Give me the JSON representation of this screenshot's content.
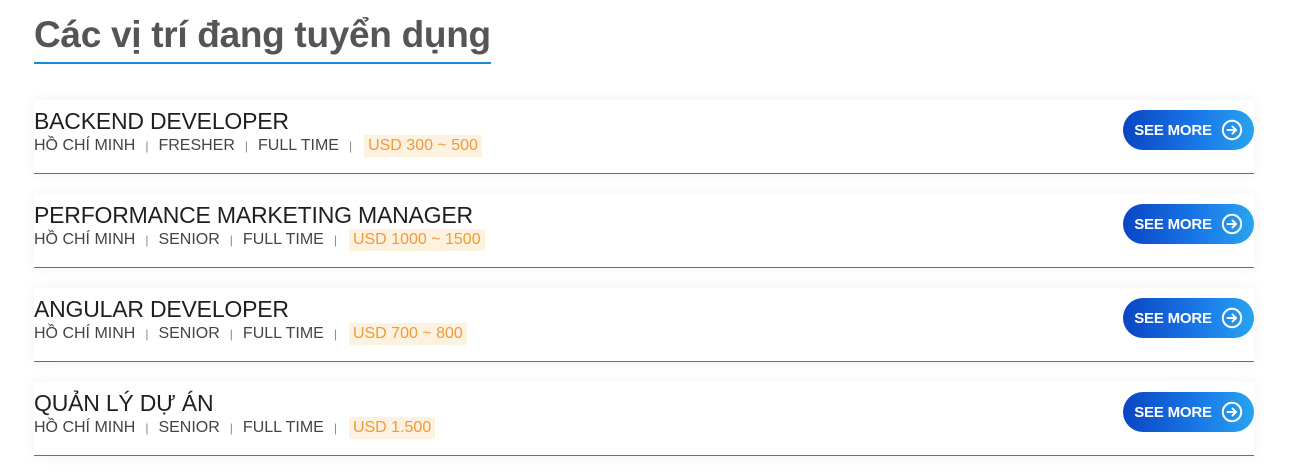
{
  "section": {
    "title": "Các vị trí đang tuyển dụng"
  },
  "jobs": [
    {
      "title": "BACKEND DEVELOPER",
      "location": "HỒ CHÍ MINH",
      "level": "FRESHER",
      "type": "FULL TIME",
      "salary": "USD 300 ~ 500",
      "button": "SEE MORE"
    },
    {
      "title": "PERFORMANCE MARKETING MANAGER",
      "location": "HỒ CHÍ MINH",
      "level": "SENIOR",
      "type": "FULL TIME",
      "salary": "USD 1000 ~ 1500",
      "button": "SEE MORE"
    },
    {
      "title": "ANGULAR DEVELOPER",
      "location": "HỒ CHÍ MINH",
      "level": "SENIOR",
      "type": "FULL TIME",
      "salary": "USD 700 ~ 800",
      "button": "SEE MORE"
    },
    {
      "title": "QUẢN LÝ DỰ ÁN",
      "location": "HỒ CHÍ MINH",
      "level": "SENIOR",
      "type": "FULL TIME",
      "salary": "USD 1.500",
      "button": "SEE MORE"
    }
  ],
  "icons": {
    "see_more": "arrow-right-circle-icon"
  },
  "colors": {
    "accent_blue": "#1e88d6",
    "button_gradient_start": "#0a45c4",
    "button_gradient_end": "#28a4ef",
    "salary_text": "#f29a38",
    "salary_bg": "#fdf1df"
  }
}
